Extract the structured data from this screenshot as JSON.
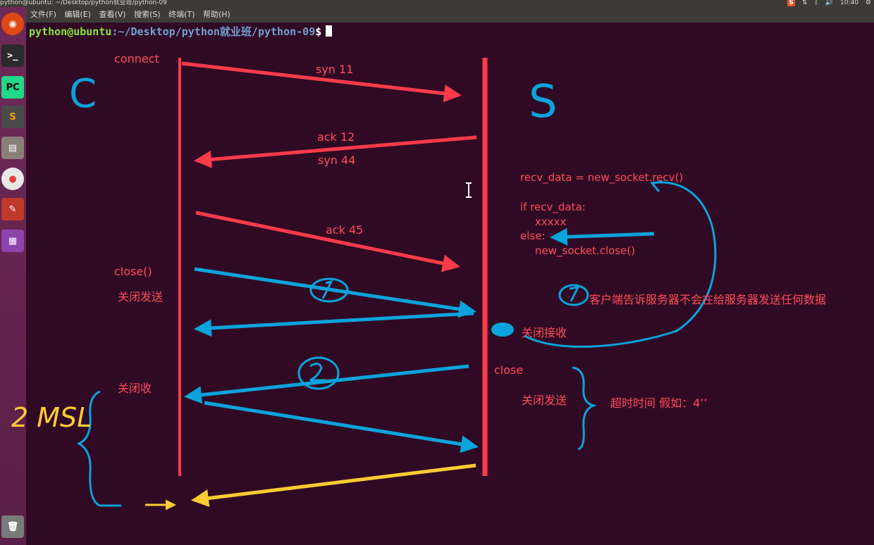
{
  "window": {
    "title": "python@ubuntu: ~/Desktop/python就业班/python-09",
    "clock": "10:40"
  },
  "menu": [
    "文件(F)",
    "编辑(E)",
    "查看(V)",
    "搜索(S)",
    "终端(T)",
    "帮助(H)"
  ],
  "launcher": [
    {
      "name": "ubuntu-dash-icon",
      "glyph": "◉"
    },
    {
      "name": "terminal-icon",
      "glyph": ">_"
    },
    {
      "name": "pycharm-icon",
      "glyph": "PC"
    },
    {
      "name": "sublime-icon",
      "glyph": "S"
    },
    {
      "name": "files-icon",
      "glyph": "▤"
    },
    {
      "name": "chrome-icon",
      "glyph": "●"
    },
    {
      "name": "settings-icon",
      "glyph": "✎"
    },
    {
      "name": "workspace-icon",
      "glyph": "▦"
    },
    {
      "name": "trash-icon",
      "glyph": "🗑"
    }
  ],
  "terminal": {
    "user_host": "python@ubuntu",
    "path": ":~/Desktop/python就业班/python-09",
    "dollar": "$"
  },
  "diagram": {
    "client_letter": "C",
    "server_letter": "S",
    "left_labels": {
      "connect": "connect",
      "close": "close()",
      "close_send": "关闭发送",
      "close_recv": "关闭收"
    },
    "arrow_labels": {
      "syn11": "syn 11",
      "ack12": "ack 12",
      "syn44": "syn 44",
      "ack45": "ack 45"
    },
    "code": [
      "recv_data = new_socket.recv()",
      "if recv_data:",
      "xxxxx",
      "else:",
      "new_socket.close()"
    ],
    "right_labels": {
      "note1": "客户端告诉服务器不会在给服务器发送任何数据",
      "close_recv": "关闭接收",
      "close": "close",
      "close_send": "关闭发送",
      "timeout": "超时时间 假如：4’’"
    },
    "msl_label": "2 MSL",
    "colors": {
      "red": "#ff3b4a",
      "blue": "#0aa3db",
      "yellow": "#ffcc33"
    }
  }
}
